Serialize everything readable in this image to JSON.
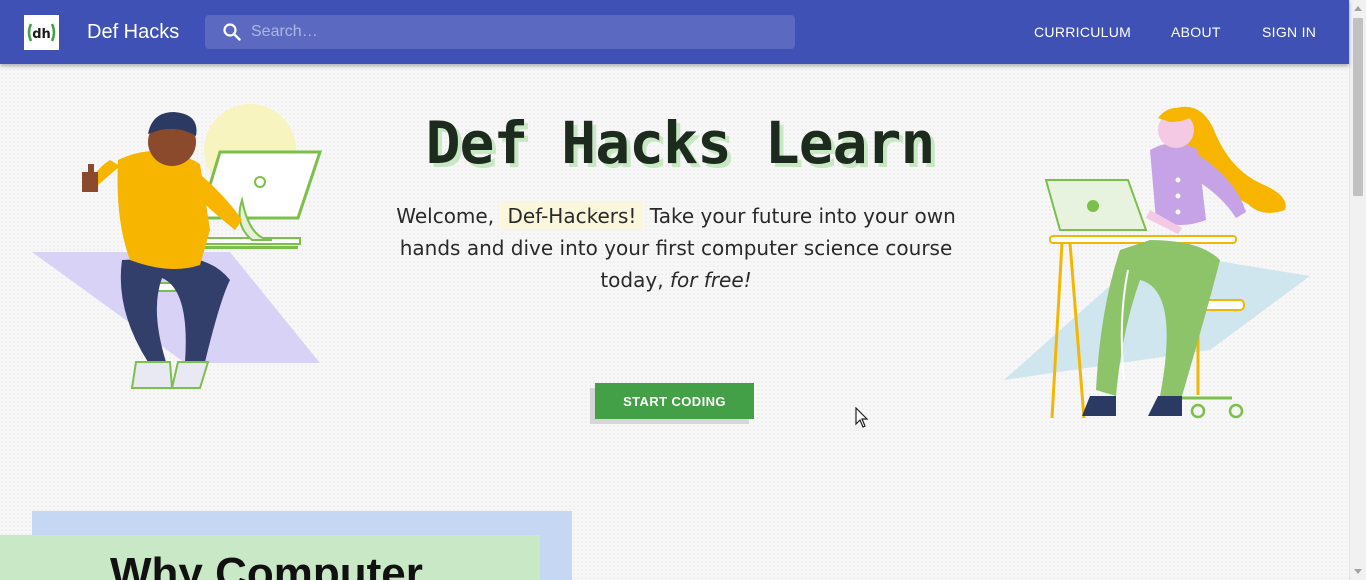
{
  "header": {
    "logo_text": "dh",
    "brand": "Def Hacks",
    "search_placeholder": "Search…",
    "nav": [
      "CURRICULUM",
      "ABOUT",
      "SIGN IN"
    ]
  },
  "hero": {
    "title": "Def Hacks Learn",
    "welcome": "Welcome,",
    "highlight": "Def-Hackers!",
    "body": "Take your future into your own hands and dive into your first computer science course today,",
    "emphasis": "for free!",
    "cta": "START CODING"
  },
  "section": {
    "heading": "Why Computer"
  },
  "icons": {
    "logo": "dh-logo-icon",
    "search": "search-icon",
    "cursor": "mouse-pointer-icon"
  },
  "colors": {
    "appbar": "#3f51b5",
    "cta": "#43a047",
    "title_shadow": "#c7e8c3",
    "highlight": "#fbf7dc",
    "section_back": "#c6d7f4",
    "section_front": "#c8e8c6"
  }
}
